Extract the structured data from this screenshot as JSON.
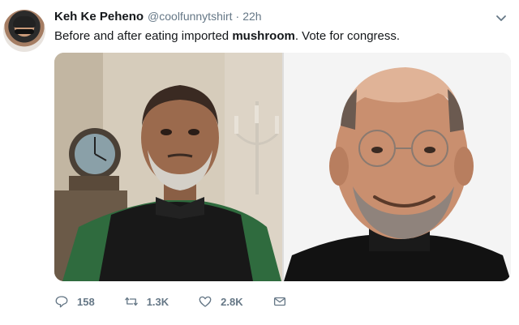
{
  "tweet": {
    "author_name": "Keh Ke Peheno",
    "handle": "@coolfunnytshirt",
    "separator": "·",
    "time": "22h",
    "text_before": "Before and after eating imported ",
    "text_bold": "mushroom",
    "text_after": ". Vote for congress.",
    "media": [
      {
        "icon": "photo-man-in-nehru-jacket"
      },
      {
        "icon": "photo-man-in-turtleneck"
      }
    ],
    "actions": {
      "reply_count": "158",
      "retweet_count": "1.3K",
      "like_count": "2.8K"
    }
  },
  "colors": {
    "accent": "#1da1f2",
    "muted": "#657786",
    "text": "#14171a"
  }
}
